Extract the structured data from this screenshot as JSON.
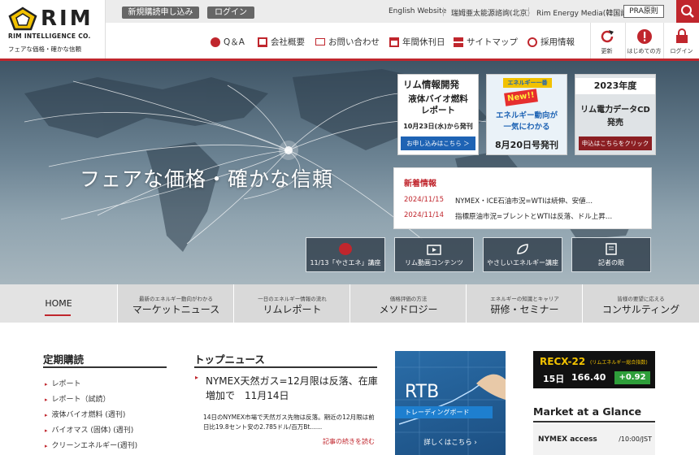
{
  "header": {
    "logo_text": "RIM",
    "company": "RIM INTELLIGENCE CO.",
    "tagline": "フェアな価格・確かな信頼",
    "subscribe_btn": "新規購読申し込み",
    "login_btn": "ログイン",
    "links": [
      "English Website",
      "瑞姆亜太能源諮詢(北京)",
      "Rim Energy Media(韓国語)"
    ],
    "pra": "PRA原則"
  },
  "nav": {
    "items": [
      "Q＆A",
      "会社概要",
      "お問い合わせ",
      "年間休刊日",
      "サイトマップ",
      "採用情報"
    ],
    "icons": [
      {
        "label": "更新"
      },
      {
        "label": "はじめての方"
      },
      {
        "label": "ログイン"
      }
    ]
  },
  "hero": {
    "title": "フェアな価格・確かな信頼",
    "promo1": {
      "head": "リム情報開発",
      "line1": "液体バイオ燃料",
      "line2": "レポート",
      "date": "10月23日(水)から発刊",
      "cta": "お申し込みはこちら ＞"
    },
    "promo2": {
      "brand": "エネルギー一番",
      "badge": "New!!",
      "line1": "エネルギー動向が",
      "line2": "一気にわかる",
      "date": "8月20日号発刊"
    },
    "promo3": {
      "year": "2023年度",
      "line1": "リム電力データCD",
      "line2": "発売",
      "cta": "申込はこちらをクリック"
    },
    "news": {
      "heading": "新着情報",
      "items": [
        {
          "date": "2024/11/15",
          "text": "NYMEX・ICE石油市況=WTIは続伸、安値…"
        },
        {
          "date": "2024/11/14",
          "text": "指標原油市況=ブレントとWTIは反落、ドル上昇…"
        }
      ]
    },
    "buttons": [
      "11/13「やさエネ」講座",
      "リム動画コンテンツ",
      "やさしいエネルギー講座",
      "記者の眼"
    ]
  },
  "menu": {
    "home": "HOME",
    "items": [
      {
        "sub": "最新のエネルギー動向がわかる",
        "main": "マーケットニュース"
      },
      {
        "sub": "一日のエネルギー情報の流れ",
        "main": "リムレポート"
      },
      {
        "sub": "価格評価の方法",
        "main": "メソドロジー"
      },
      {
        "sub": "エネルギーの知識とキャリア",
        "main": "研修・セミナー"
      },
      {
        "sub": "皆様の要望に応える",
        "main": "コンサルティング"
      }
    ]
  },
  "left": {
    "heading": "定期購読",
    "links": [
      "レポート",
      "レポート（試読）",
      "液体バイオ燃料 (週刊)",
      "バイオマス (固体) (週刊)",
      "クリーンエネルギー(週刊)"
    ]
  },
  "topnews": {
    "heading": "トップニュース",
    "title": "NYMEX天然ガス=12月限は反落、在庫増加で　11月14日",
    "body": "14日のNYMEX市場で天然ガス先物は反落。期近の12月限は前日比19.8セント安の2.785ドル/百万Bt……",
    "more": "記事の続きを読む"
  },
  "rtb": {
    "title": "RTB",
    "sub": "トレーディングボード",
    "cta": "詳しくはこちら ›"
  },
  "recx": {
    "name": "RECX-22",
    "desc": "(リムエネルギー総合指数)",
    "day": "15日",
    "value": "166.40",
    "change": "+0.92"
  },
  "glance": {
    "heading": "Market at a Glance",
    "item": "NYMEX access",
    "time": "/10:00/JST"
  },
  "colors": {
    "accent": "#c0262d",
    "menu_bg": "#d9d9d9",
    "hero_dark": "#3f5566"
  }
}
